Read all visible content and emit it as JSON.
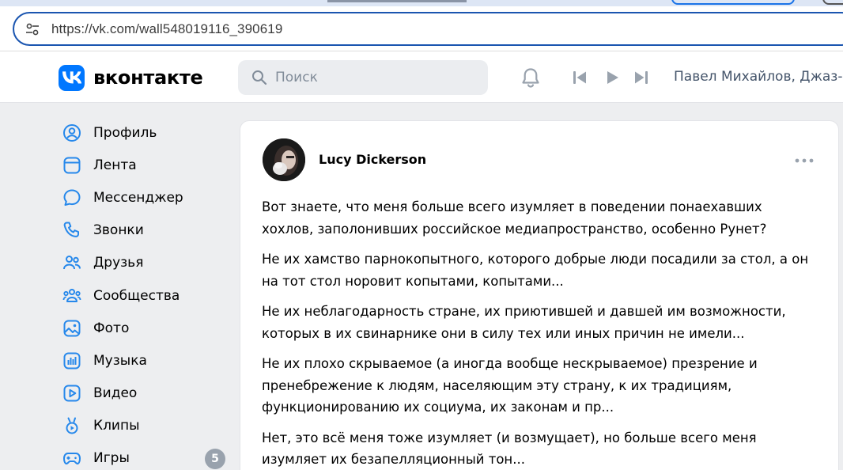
{
  "browser": {
    "url": "https://vk.com/wall548019116_390619",
    "icons": {
      "site_info": "tune-icon"
    }
  },
  "header": {
    "logo_text": "вконтакте",
    "search_placeholder": "Поиск",
    "now_playing": "Павел Михайлов, Джаз-",
    "icons": [
      "bell-icon",
      "skip-previous-icon",
      "play-icon",
      "skip-next-icon"
    ],
    "brand_color": "#0077ff"
  },
  "sidebar": {
    "items": [
      {
        "label": "Профиль",
        "icon": "profile-icon"
      },
      {
        "label": "Лента",
        "icon": "feed-icon"
      },
      {
        "label": "Мессенджер",
        "icon": "messenger-icon"
      },
      {
        "label": "Звонки",
        "icon": "phone-icon"
      },
      {
        "label": "Друзья",
        "icon": "friends-icon"
      },
      {
        "label": "Сообщества",
        "icon": "communities-icon"
      },
      {
        "label": "Фото",
        "icon": "photo-icon"
      },
      {
        "label": "Музыка",
        "icon": "music-icon"
      },
      {
        "label": "Видео",
        "icon": "video-icon"
      },
      {
        "label": "Клипы",
        "icon": "clips-icon"
      },
      {
        "label": "Игры",
        "icon": "games-icon",
        "badge": "5"
      }
    ],
    "icon_color": "#2688eb"
  },
  "post": {
    "author": "Lucy Dickerson",
    "paragraphs": [
      "Вот знаете, что меня больше всего изумляет в поведении понаехавших хохлов, заполонивших российское медиапространство, особенно Рунет?",
      "Не их хамство парнокопытного, которого добрые люди посадили за стол, а он на тот стол норовит копытами, копытами...",
      "Не их неблагодарность стране, их приютившей и давшей им возможности, которых в их свинарнике они в силу тех или иных причин не имели...",
      "Не их плохо скрываемое (а иногда вообще нескрываемое) презрение и пренебрежение к людям, населяющим эту страну, к их традициям, функционированию их социума, их законам и пр...",
      "Нет, это всё меня тоже изумляет (и возмущает), но больше всего меня изумляет их безапелляционный тон..."
    ]
  }
}
